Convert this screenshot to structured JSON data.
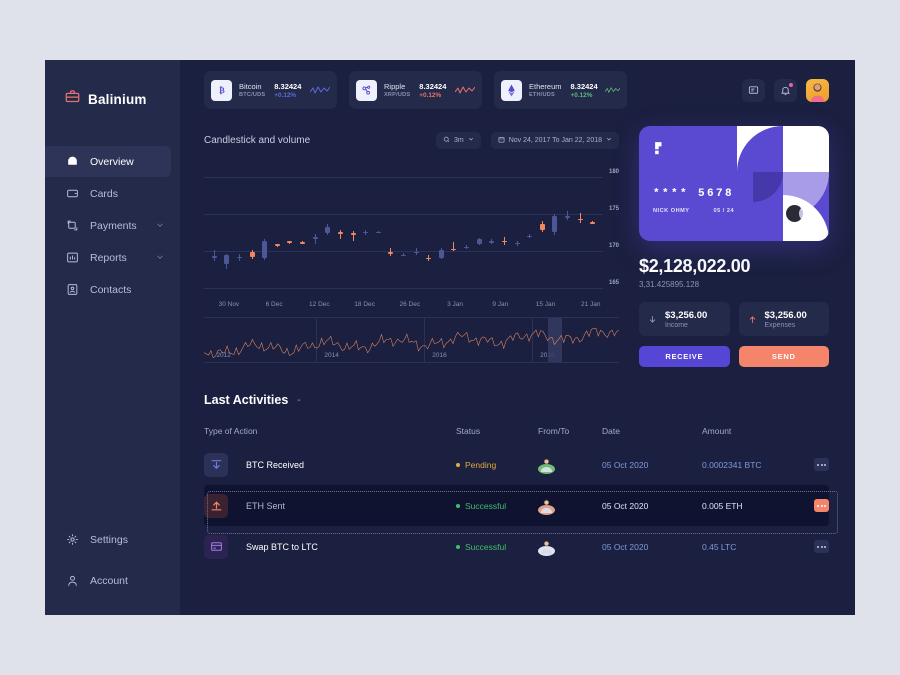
{
  "brand": {
    "name": "Balinium",
    "icon": "briefcase-icon"
  },
  "sidebar": {
    "items": [
      {
        "label": "Overview",
        "icon": "overview-icon",
        "active": true,
        "chevron": false
      },
      {
        "label": "Cards",
        "icon": "card-icon",
        "active": false,
        "chevron": false
      },
      {
        "label": "Payments",
        "icon": "payments-icon",
        "active": false,
        "chevron": true
      },
      {
        "label": "Reports",
        "icon": "reports-icon",
        "active": false,
        "chevron": true
      },
      {
        "label": "Contacts",
        "icon": "contacts-icon",
        "active": false,
        "chevron": false
      }
    ],
    "bottom": [
      {
        "label": "Settings",
        "icon": "gear-icon"
      },
      {
        "label": "Account",
        "icon": "user-icon"
      }
    ]
  },
  "topbar": {
    "tickers": [
      {
        "name": "Bitcoin",
        "pair": "BTC/UDS",
        "price": "8.32424",
        "change": "+0.12%",
        "color": "#5a6bd8",
        "symbol": "bitcoin-icon"
      },
      {
        "name": "Ripple",
        "pair": "XRP/UDS",
        "price": "8.32424",
        "change": "+0.12%",
        "color": "#e8726d",
        "symbol": "ripple-icon"
      },
      {
        "name": "Ethereum",
        "pair": "ETH/UDS",
        "price": "8.32424",
        "change": "+0.12%",
        "color": "#5cba7d",
        "symbol": "ethereum-icon"
      }
    ],
    "message_icon": "message-icon",
    "bell_icon": "bell-icon",
    "avatar": "user-avatar"
  },
  "chart_panel": {
    "title": "Candlestick and volume",
    "range_label": "3m",
    "range_icon": "search-icon",
    "date_label": "Nov 24, 2017 To  Jan 22, 2018",
    "date_icon": "calendar-icon"
  },
  "chart_data": {
    "type": "candlestick",
    "title": "Candlestick and volume",
    "ylabel": "",
    "xlabel": "",
    "ylim": [
      163.5,
      181.5
    ],
    "yticks": [
      180,
      175,
      170,
      165
    ],
    "grid": true,
    "xticks": [
      "30 Nov",
      "6 Dec",
      "12 Dec",
      "18 Dec",
      "26 Dec",
      "3 Jan",
      "9 Jan",
      "15 Jan",
      "21 Jan"
    ],
    "candles": [
      {
        "o": 169.3,
        "c": 169.0,
        "h": 170.2,
        "l": 168.6,
        "dir": "down"
      },
      {
        "o": 169.4,
        "c": 168.2,
        "h": 169.6,
        "l": 167.6,
        "dir": "down"
      },
      {
        "o": 169.2,
        "c": 169.0,
        "h": 169.6,
        "l": 168.7,
        "dir": "down"
      },
      {
        "o": 169.2,
        "c": 169.9,
        "h": 170.2,
        "l": 168.9,
        "dir": "up"
      },
      {
        "o": 171.3,
        "c": 169.0,
        "h": 171.6,
        "l": 168.8,
        "dir": "down"
      },
      {
        "o": 170.6,
        "c": 170.9,
        "h": 171.0,
        "l": 170.5,
        "dir": "up"
      },
      {
        "o": 171.1,
        "c": 171.3,
        "h": 171.4,
        "l": 171.0,
        "dir": "up"
      },
      {
        "o": 171.0,
        "c": 171.2,
        "h": 171.4,
        "l": 170.9,
        "dir": "up"
      },
      {
        "o": 171.6,
        "c": 171.9,
        "h": 172.3,
        "l": 171.0,
        "dir": "down"
      },
      {
        "o": 173.3,
        "c": 172.4,
        "h": 173.6,
        "l": 172.2,
        "dir": "down"
      },
      {
        "o": 172.6,
        "c": 172.3,
        "h": 172.9,
        "l": 171.6,
        "dir": "up"
      },
      {
        "o": 172.4,
        "c": 172.2,
        "h": 172.7,
        "l": 171.4,
        "dir": "up"
      },
      {
        "o": 172.4,
        "c": 172.6,
        "h": 172.9,
        "l": 172.2,
        "dir": "down"
      },
      {
        "o": 172.5,
        "c": 172.6,
        "h": 172.7,
        "l": 172.4,
        "dir": "down"
      },
      {
        "o": 169.8,
        "c": 169.8,
        "h": 170.4,
        "l": 169.3,
        "dir": "up"
      },
      {
        "o": 169.5,
        "c": 169.4,
        "h": 169.7,
        "l": 169.3,
        "dir": "down"
      },
      {
        "o": 169.8,
        "c": 169.9,
        "h": 170.4,
        "l": 169.4,
        "dir": "down"
      },
      {
        "o": 169.1,
        "c": 168.9,
        "h": 169.4,
        "l": 168.7,
        "dir": "up"
      },
      {
        "o": 170.2,
        "c": 169.1,
        "h": 170.4,
        "l": 168.9,
        "dir": "down"
      },
      {
        "o": 170.3,
        "c": 170.2,
        "h": 171.2,
        "l": 170.0,
        "dir": "up"
      },
      {
        "o": 170.5,
        "c": 170.6,
        "h": 170.8,
        "l": 170.3,
        "dir": "down"
      },
      {
        "o": 171.6,
        "c": 171.0,
        "h": 171.8,
        "l": 170.8,
        "dir": "down"
      },
      {
        "o": 171.3,
        "c": 171.2,
        "h": 171.6,
        "l": 170.9,
        "dir": "down"
      },
      {
        "o": 171.4,
        "c": 171.3,
        "h": 171.9,
        "l": 170.8,
        "dir": "up"
      },
      {
        "o": 171.1,
        "c": 170.9,
        "h": 171.3,
        "l": 170.7,
        "dir": "down"
      },
      {
        "o": 171.9,
        "c": 172.1,
        "h": 172.3,
        "l": 171.8,
        "dir": "down"
      },
      {
        "o": 173.6,
        "c": 172.9,
        "h": 174.1,
        "l": 172.6,
        "dir": "up"
      },
      {
        "o": 174.8,
        "c": 172.6,
        "h": 175.0,
        "l": 172.1,
        "dir": "down"
      },
      {
        "o": 174.7,
        "c": 174.6,
        "h": 175.4,
        "l": 174.2,
        "dir": "down"
      },
      {
        "o": 174.4,
        "c": 174.2,
        "h": 175.2,
        "l": 173.8,
        "dir": "up"
      },
      {
        "o": 173.9,
        "c": 173.8,
        "h": 174.1,
        "l": 173.6,
        "dir": "up"
      }
    ],
    "volume": {
      "type": "area-line",
      "year_labels": [
        "2012",
        "2014",
        "2016",
        "2018"
      ],
      "selection_highlight": true,
      "line_color": "#e58a63"
    }
  },
  "card": {
    "number": "****  5678",
    "holder": "NICK OHMY",
    "expiry": "05 / 24",
    "chip_icon": "card-chip-icon",
    "contactless_icon": "contactless-icon",
    "brand_icon": "mastercard-icon",
    "accent": "#5a4ad1"
  },
  "balance": {
    "amount": "$2,128,022.00",
    "sub": "3,31.425895.128"
  },
  "stats": [
    {
      "value": "$3,256.00",
      "label": "Income",
      "icon": "arrow-down-icon",
      "color": "#8d93b5"
    },
    {
      "value": "$3,256.00",
      "label": "Expenses",
      "icon": "arrow-up-icon",
      "color": "#e8726d"
    }
  ],
  "buttons": {
    "receive": "RECEIVE",
    "send": "SEND"
  },
  "activities": {
    "title": "Last Activities",
    "caret": "-",
    "columns": [
      "Type of Action",
      "Status",
      "From/To",
      "Date",
      "Amount"
    ],
    "rows": [
      {
        "type": "BTC Received",
        "icon": "receive-icon",
        "icon_bg": "#2b3157",
        "icon_color": "#6d7ae0",
        "status": "Pending",
        "status_color": "#e0a93c",
        "avatar_color": "#6fbf73",
        "date": "05 Oct 2020",
        "amount": "0.0002341 BTC",
        "selected": false,
        "menu_hot": false
      },
      {
        "type": "ETH Sent",
        "icon": "send-icon",
        "icon_bg": "#3a2230",
        "icon_color": "#f4846a",
        "status": "Successful",
        "status_color": "#3fbf6a",
        "avatar_color": "#e2a184",
        "date": "05 Oct 2020",
        "amount": "0.005 ETH",
        "selected": true,
        "menu_hot": true
      },
      {
        "type": "Swap BTC to LTC",
        "icon": "swap-icon",
        "icon_bg": "#2b2450",
        "icon_color": "#a77ae8",
        "status": "Successful",
        "status_color": "#3fbf6a",
        "avatar_color": "#dfe3f2",
        "date": "05 Oct 2020",
        "amount": "0.45 LTC",
        "selected": false,
        "menu_hot": false
      }
    ]
  }
}
